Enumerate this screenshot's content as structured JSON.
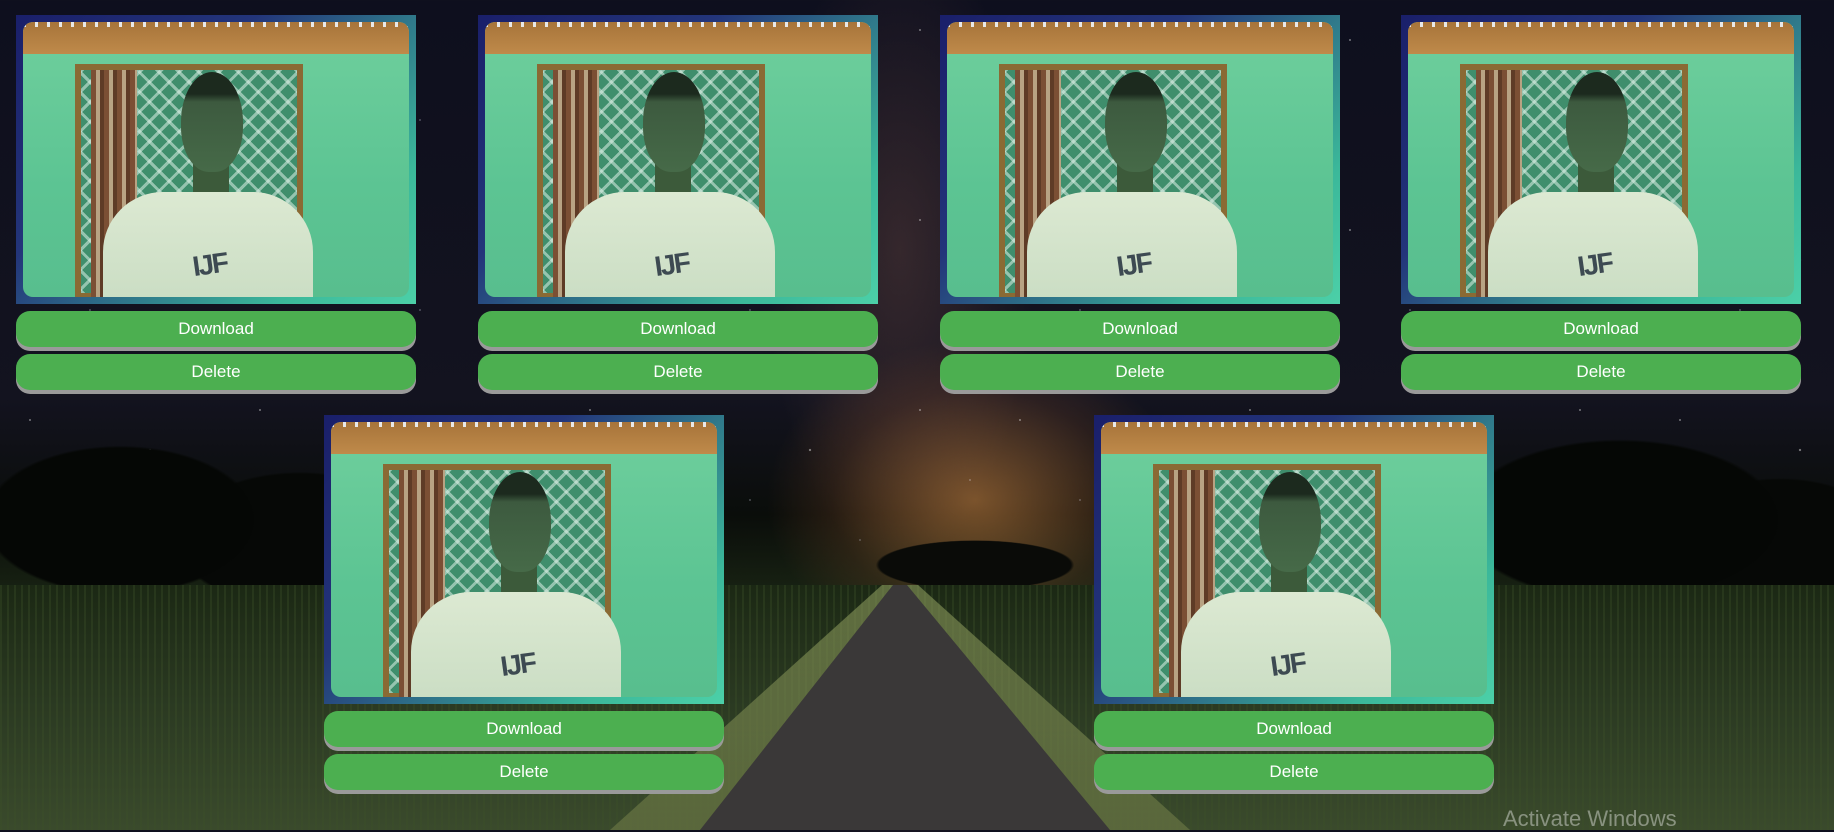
{
  "cards": [
    {
      "image_label": "webcam-snapshot",
      "download_label": "Download",
      "delete_label": "Delete"
    },
    {
      "image_label": "webcam-snapshot",
      "download_label": "Download",
      "delete_label": "Delete"
    },
    {
      "image_label": "webcam-snapshot",
      "download_label": "Download",
      "delete_label": "Delete"
    },
    {
      "image_label": "webcam-snapshot",
      "download_label": "Download",
      "delete_label": "Delete"
    },
    {
      "image_label": "webcam-snapshot",
      "download_label": "Download",
      "delete_label": "Delete"
    },
    {
      "image_label": "webcam-snapshot",
      "download_label": "Download",
      "delete_label": "Delete"
    }
  ],
  "watermark": "Activate Windows",
  "colors": {
    "button_bg": "#4caf50",
    "button_text": "#ffffff",
    "frame_gradient_start": "#1a1f6a",
    "frame_gradient_end": "#4cd0a8"
  }
}
